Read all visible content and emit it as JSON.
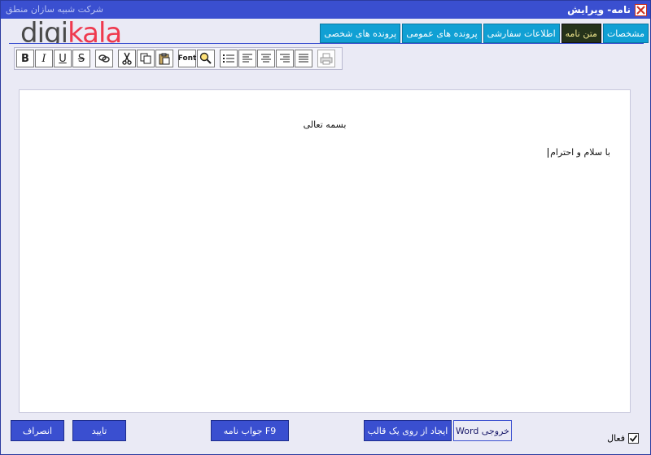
{
  "window": {
    "title": "نامه- ويرايش",
    "company": "شرکت شبیه سازان منطق"
  },
  "logo": {
    "part1": "digi",
    "part2": "kala"
  },
  "tabs": [
    {
      "label": "مشخصات"
    },
    {
      "label": "متن نامه"
    },
    {
      "label": "اطلاعات سفارشی"
    },
    {
      "label": "پرونده های عمومی"
    },
    {
      "label": "پرونده های شخصی"
    }
  ],
  "toolbar": {
    "bold": "B",
    "italic": "I",
    "underline": "U",
    "strike": "S",
    "font": "Font"
  },
  "editor": {
    "salutation": "بسمه تعالی",
    "greeting": "با سلام و احترام"
  },
  "buttons": {
    "cancel": "انصراف",
    "confirm": "تایید",
    "reply": "F9 جواب نامه",
    "from_template": "ایجاد از روی یک قالب",
    "word_export": "خروجی Word"
  },
  "checkbox": {
    "label": "فعال",
    "checked": true
  }
}
